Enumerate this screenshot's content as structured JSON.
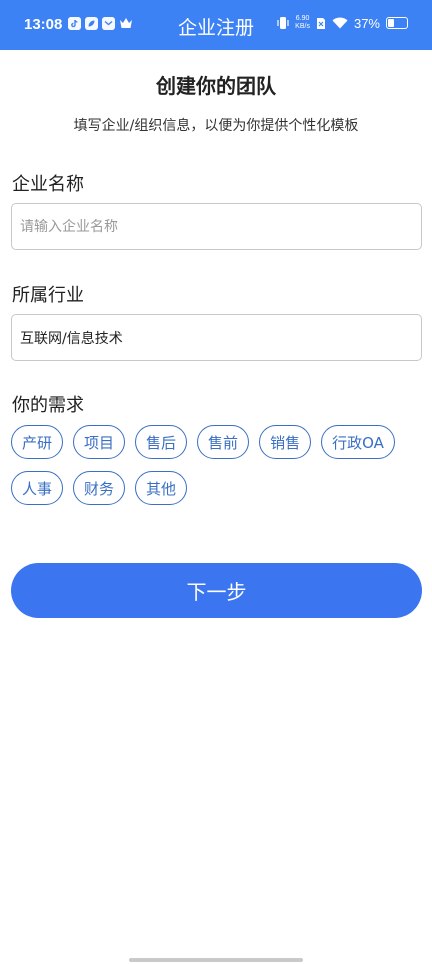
{
  "status_bar": {
    "time": "13:08",
    "net_speed_value": "6.90",
    "net_speed_unit": "KB/s",
    "battery": "37%",
    "battery_level": 0.37,
    "app_icons": [
      "tiktok-icon",
      "leaf-app-icon",
      "mail-app-icon",
      "crown-app-icon"
    ],
    "system_icons": [
      "vibrate-icon",
      "sim-icon",
      "wifi-icon",
      "battery-icon"
    ]
  },
  "header": {
    "title": "企业注册",
    "background": "#3d82f5"
  },
  "main": {
    "heading": "创建你的团队",
    "subheading": "填写企业/组织信息，以便为你提供个性化模板"
  },
  "form": {
    "company_name": {
      "label": "企业名称",
      "value": "",
      "placeholder": "请输入企业名称"
    },
    "industry": {
      "label": "所属行业",
      "value": "互联网/信息技术"
    },
    "needs": {
      "label": "你的需求",
      "tags": [
        "产研",
        "项目",
        "售后",
        "售前",
        "销售",
        "行政OA",
        "人事",
        "财务",
        "其他"
      ]
    }
  },
  "actions": {
    "next_label": "下一步",
    "accent": "#3b75f0"
  }
}
